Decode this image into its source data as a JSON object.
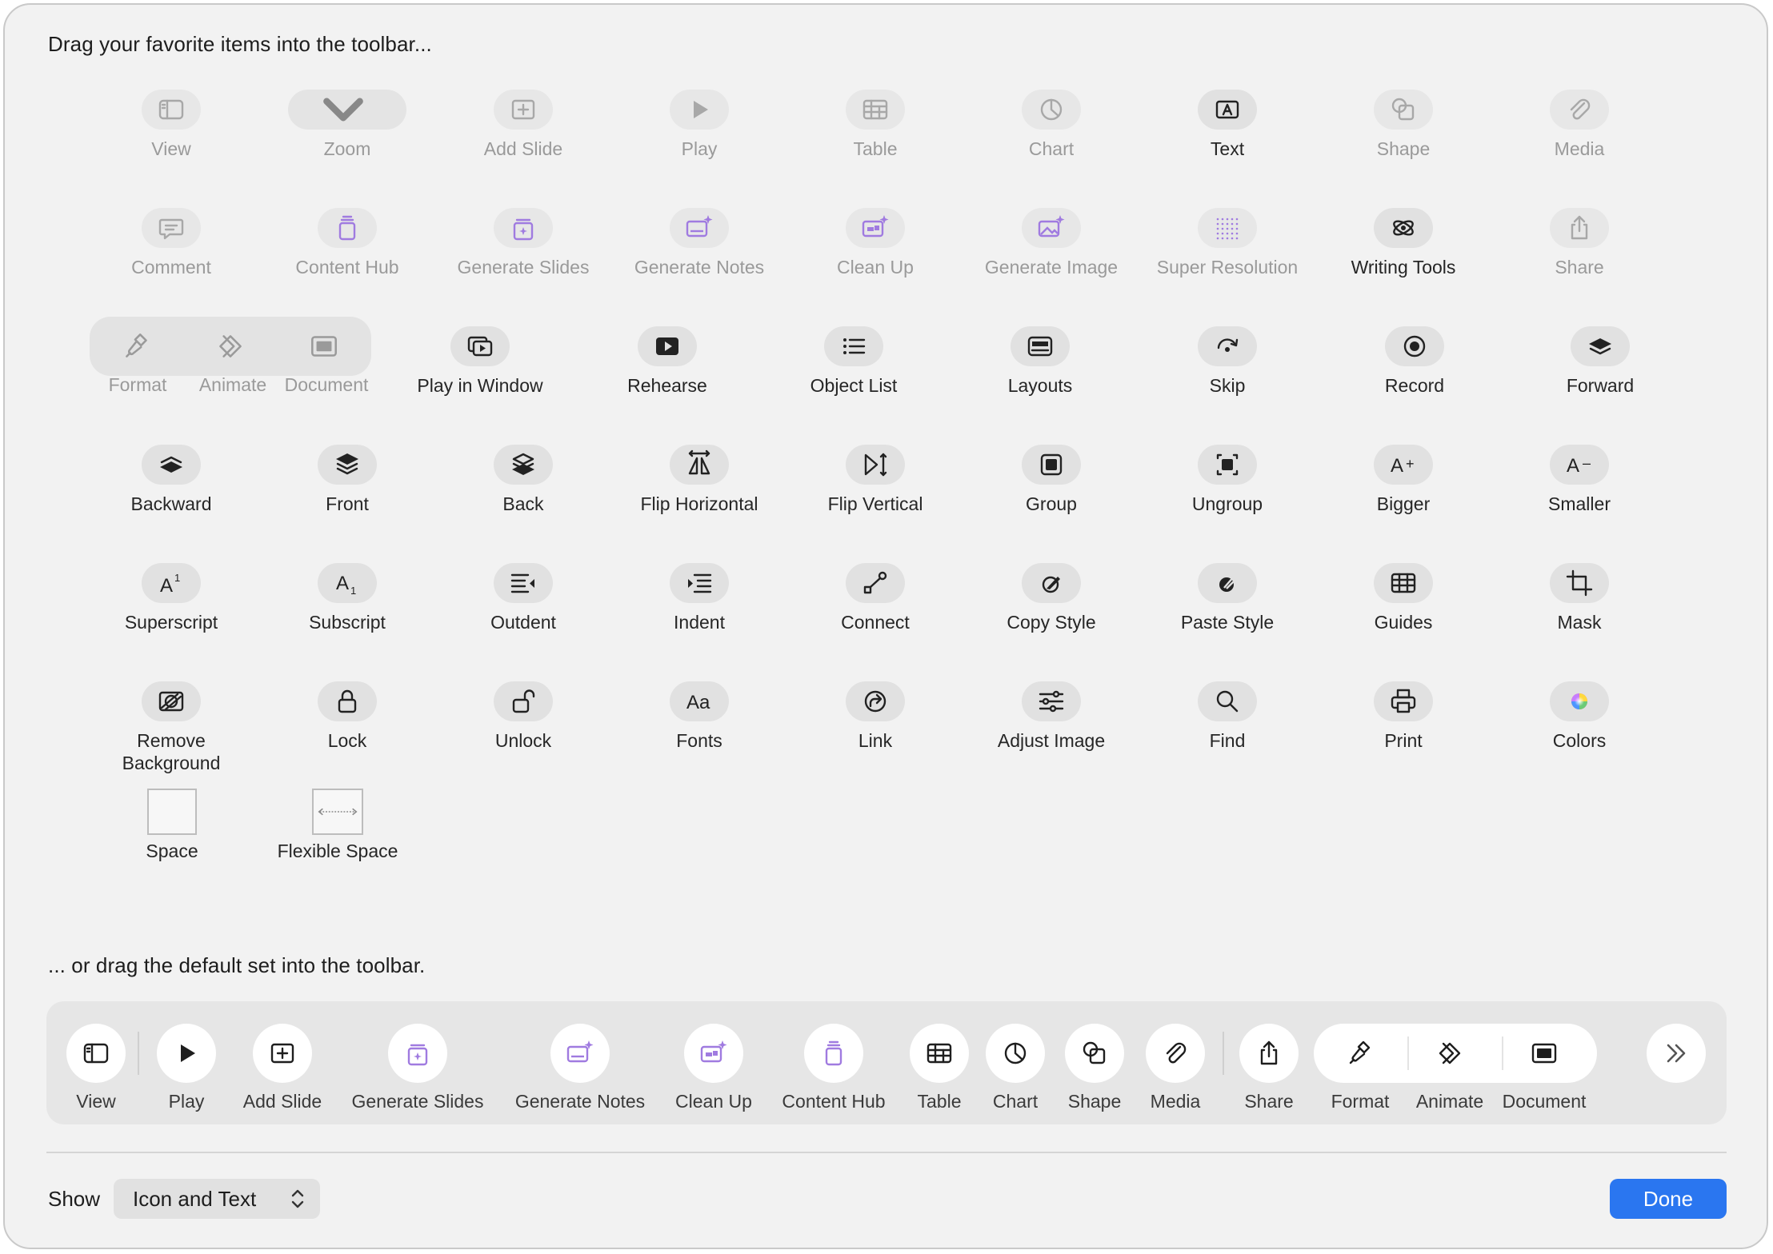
{
  "heading_top": "Drag your favorite items into the toolbar...",
  "heading_bottom": "... or drag the default set into the toolbar.",
  "palette": [
    {
      "label": "View",
      "icon": "sidebar-icon",
      "dim": true
    },
    {
      "label": "Zoom",
      "icon": "zoom-popup",
      "dim": true
    },
    {
      "label": "Add Slide",
      "icon": "add-slide-icon",
      "dim": true
    },
    {
      "label": "Play",
      "icon": "play-icon",
      "dim": true
    },
    {
      "label": "Table",
      "icon": "table-icon",
      "dim": true
    },
    {
      "label": "Chart",
      "icon": "chart-icon",
      "dim": true
    },
    {
      "label": "Text",
      "icon": "text-box-icon",
      "dim": false
    },
    {
      "label": "Shape",
      "icon": "shape-icon",
      "dim": true
    },
    {
      "label": "Media",
      "icon": "paperclip-icon",
      "dim": true
    },
    {
      "label": "Comment",
      "icon": "comment-icon",
      "dim": true
    },
    {
      "label": "Content Hub",
      "icon": "content-hub-icon",
      "dim": true
    },
    {
      "label": "Generate Slides",
      "icon": "generate-slides-icon",
      "dim": true
    },
    {
      "label": "Generate Notes",
      "icon": "generate-notes-icon",
      "dim": true
    },
    {
      "label": "Clean Up",
      "icon": "clean-up-icon",
      "dim": true
    },
    {
      "label": "Generate Image",
      "icon": "generate-image-icon",
      "dim": true
    },
    {
      "label": "Super Resolution",
      "icon": "super-resolution-icon",
      "dim": true
    },
    {
      "label": "Writing Tools",
      "icon": "writing-tools-icon",
      "dim": false
    },
    {
      "label": "Share",
      "icon": "share-icon",
      "dim": true
    },
    {
      "label": "Play in Window",
      "icon": "play-in-window-icon",
      "dim": false
    },
    {
      "label": "Rehearse",
      "icon": "rehearse-icon",
      "dim": false
    },
    {
      "label": "Object List",
      "icon": "object-list-icon",
      "dim": false
    },
    {
      "label": "Layouts",
      "icon": "layouts-icon",
      "dim": false
    },
    {
      "label": "Skip",
      "icon": "skip-icon",
      "dim": false
    },
    {
      "label": "Record",
      "icon": "record-icon",
      "dim": false
    },
    {
      "label": "Forward",
      "icon": "forward-icon",
      "dim": false
    },
    {
      "label": "Backward",
      "icon": "backward-icon",
      "dim": false
    },
    {
      "label": "Front",
      "icon": "front-icon",
      "dim": false
    },
    {
      "label": "Back",
      "icon": "back-icon",
      "dim": false
    },
    {
      "label": "Flip Horizontal",
      "icon": "flip-horizontal-icon",
      "dim": false
    },
    {
      "label": "Flip Vertical",
      "icon": "flip-vertical-icon",
      "dim": false
    },
    {
      "label": "Group",
      "icon": "group-icon",
      "dim": false
    },
    {
      "label": "Ungroup",
      "icon": "ungroup-icon",
      "dim": false
    },
    {
      "label": "Bigger",
      "icon": "bigger-icon",
      "dim": false
    },
    {
      "label": "Smaller",
      "icon": "smaller-icon",
      "dim": false
    },
    {
      "label": "Superscript",
      "icon": "superscript-icon",
      "dim": false
    },
    {
      "label": "Subscript",
      "icon": "subscript-icon",
      "dim": false
    },
    {
      "label": "Outdent",
      "icon": "outdent-icon",
      "dim": false
    },
    {
      "label": "Indent",
      "icon": "indent-icon",
      "dim": false
    },
    {
      "label": "Connect",
      "icon": "connect-icon",
      "dim": false
    },
    {
      "label": "Copy Style",
      "icon": "copy-style-icon",
      "dim": false
    },
    {
      "label": "Paste Style",
      "icon": "paste-style-icon",
      "dim": false
    },
    {
      "label": "Guides",
      "icon": "guides-icon",
      "dim": false
    },
    {
      "label": "Mask",
      "icon": "mask-icon",
      "dim": false
    },
    {
      "label": "Remove Background",
      "icon": "remove-background-icon",
      "dim": false
    },
    {
      "label": "Lock",
      "icon": "lock-icon",
      "dim": false
    },
    {
      "label": "Unlock",
      "icon": "unlock-icon",
      "dim": false
    },
    {
      "label": "Fonts",
      "icon": "fonts-icon",
      "dim": false
    },
    {
      "label": "Link",
      "icon": "link-icon",
      "dim": false
    },
    {
      "label": "Adjust Image",
      "icon": "adjust-image-icon",
      "dim": false
    },
    {
      "label": "Find",
      "icon": "find-icon",
      "dim": false
    },
    {
      "label": "Print",
      "icon": "print-icon",
      "dim": false
    },
    {
      "label": "Colors",
      "icon": "colors-icon",
      "dim": false
    },
    {
      "label": "Space",
      "icon": "space-box",
      "dim": false
    },
    {
      "label": "Flexible Space",
      "icon": "flexible-space-box",
      "dim": false
    }
  ],
  "group3": [
    {
      "label": "Format",
      "icon": "format-brush-icon"
    },
    {
      "label": "Animate",
      "icon": "animate-icon"
    },
    {
      "label": "Document",
      "icon": "document-icon"
    }
  ],
  "default_set": [
    {
      "label": "View",
      "icon": "sidebar-icon"
    },
    {
      "label": "Play",
      "icon": "play-icon"
    },
    {
      "label": "Add Slide",
      "icon": "add-slide-icon"
    },
    {
      "label": "Generate Slides",
      "icon": "generate-slides-icon"
    },
    {
      "label": "Generate Notes",
      "icon": "generate-notes-icon"
    },
    {
      "label": "Clean Up",
      "icon": "clean-up-icon"
    },
    {
      "label": "Content Hub",
      "icon": "content-hub-icon"
    },
    {
      "label": "Table",
      "icon": "table-icon"
    },
    {
      "label": "Chart",
      "icon": "chart-icon"
    },
    {
      "label": "Shape",
      "icon": "shape-icon"
    },
    {
      "label": "Media",
      "icon": "paperclip-icon"
    },
    {
      "label": "Share",
      "icon": "share-icon"
    },
    {
      "label": "Format",
      "icon": "format-brush-icon"
    },
    {
      "label": "Animate",
      "icon": "animate-icon"
    },
    {
      "label": "Document",
      "icon": "document-icon"
    }
  ],
  "more_icon": "chevron-double-right-icon",
  "show": {
    "label": "Show",
    "value": "Icon and Text"
  },
  "done_label": "Done",
  "colors": {
    "accent": "#2a76f0",
    "ai_purple": "#a07be0",
    "sheet": "#f2f2f2"
  }
}
